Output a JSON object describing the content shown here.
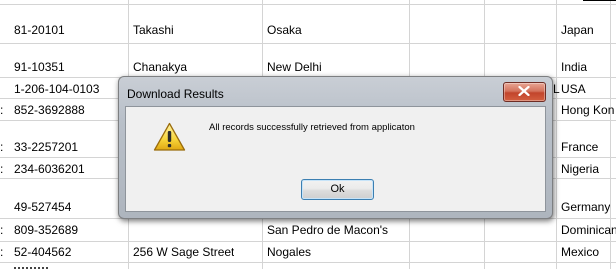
{
  "table": {
    "rows": [
      {
        "c0": "",
        "c1": "81-20101",
        "c2": "Takashi",
        "c3": "Osaka",
        "c4": "Japan"
      },
      {
        "c0": "",
        "c1": "91-10351",
        "c2": "Chanakya",
        "c3": "New Delhi",
        "c4": "India"
      },
      {
        "c0": "",
        "c1": "1-206-104-0103",
        "c2": "",
        "c3": "",
        "c4": "USA"
      },
      {
        "c0": ":",
        "c1": "852-3692888",
        "c2": "",
        "c3": "",
        "c4": "Hong Kon"
      },
      {
        "c0": ":",
        "c1": "33-2257201",
        "c2": "",
        "c3": "",
        "c4": "France"
      },
      {
        "c0": ":",
        "c1": "234-6036201",
        "c2": "",
        "c3": "",
        "c4": "Nigeria"
      },
      {
        "c0": "",
        "c1": "49-527454",
        "c2": "",
        "c3": "",
        "c4": "Germany"
      },
      {
        "c0": ":",
        "c1": "809-352689",
        "c2": "",
        "c3": "San Pedro de Macon's",
        "c4": "Dominican"
      },
      {
        "c0": ":",
        "c1": "52-404562",
        "c2": "256 W Sage Street",
        "c3": "Nogales",
        "c4": "Mexico"
      }
    ],
    "stray_marker": "L"
  },
  "dialog": {
    "title": "Download Results",
    "message": "All records successfully retrieved from applicaton",
    "ok_label": "Ok",
    "icon": "warning-icon",
    "close_icon": "close-icon"
  }
}
